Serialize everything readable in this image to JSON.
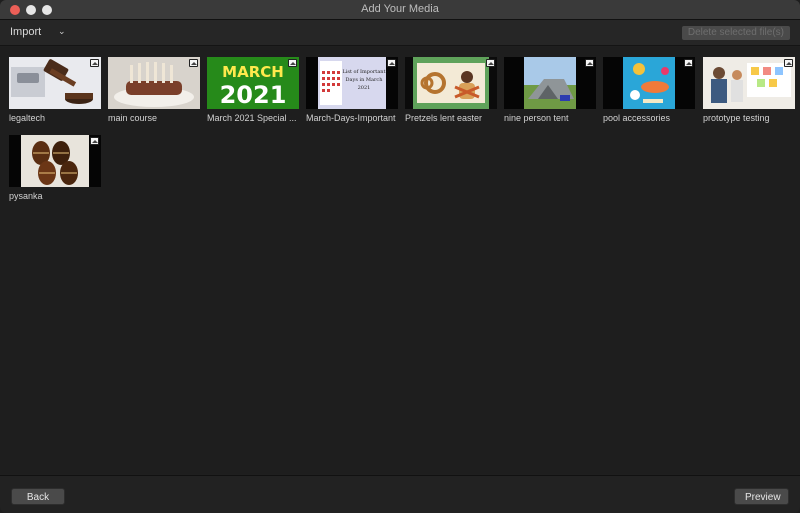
{
  "window": {
    "title": "Add Your Media"
  },
  "toolbar": {
    "import_label": "Import",
    "delete_label": "Delete selected file(s)"
  },
  "media": [
    {
      "title": "legaltech",
      "kind": "image",
      "icon": "image-icon"
    },
    {
      "title": "main course",
      "kind": "image",
      "icon": "image-icon"
    },
    {
      "title": "March 2021 Special ...",
      "kind": "image",
      "icon": "image-icon"
    },
    {
      "title": "March-Days-Important",
      "kind": "image",
      "icon": "image-icon"
    },
    {
      "title": "Pretzels lent easter",
      "kind": "image",
      "icon": "image-icon"
    },
    {
      "title": "nine person tent",
      "kind": "image",
      "icon": "image-icon"
    },
    {
      "title": "pool accessories",
      "kind": "image",
      "icon": "image-icon"
    },
    {
      "title": "prototype testing",
      "kind": "image",
      "icon": "image-icon"
    },
    {
      "title": "pysanka",
      "kind": "image",
      "icon": "image-icon"
    }
  ],
  "thumb_text": {
    "march_word": "MARCH",
    "march_year": "2021",
    "list_line1": "List of Important",
    "list_line2": "Days in March",
    "list_line3": "2021"
  },
  "footer": {
    "back_label": "Back",
    "preview_label": "Preview"
  },
  "colors": {
    "close": "#ec5f57",
    "background": "#1e1e1e",
    "button": "#4a4a4a"
  }
}
